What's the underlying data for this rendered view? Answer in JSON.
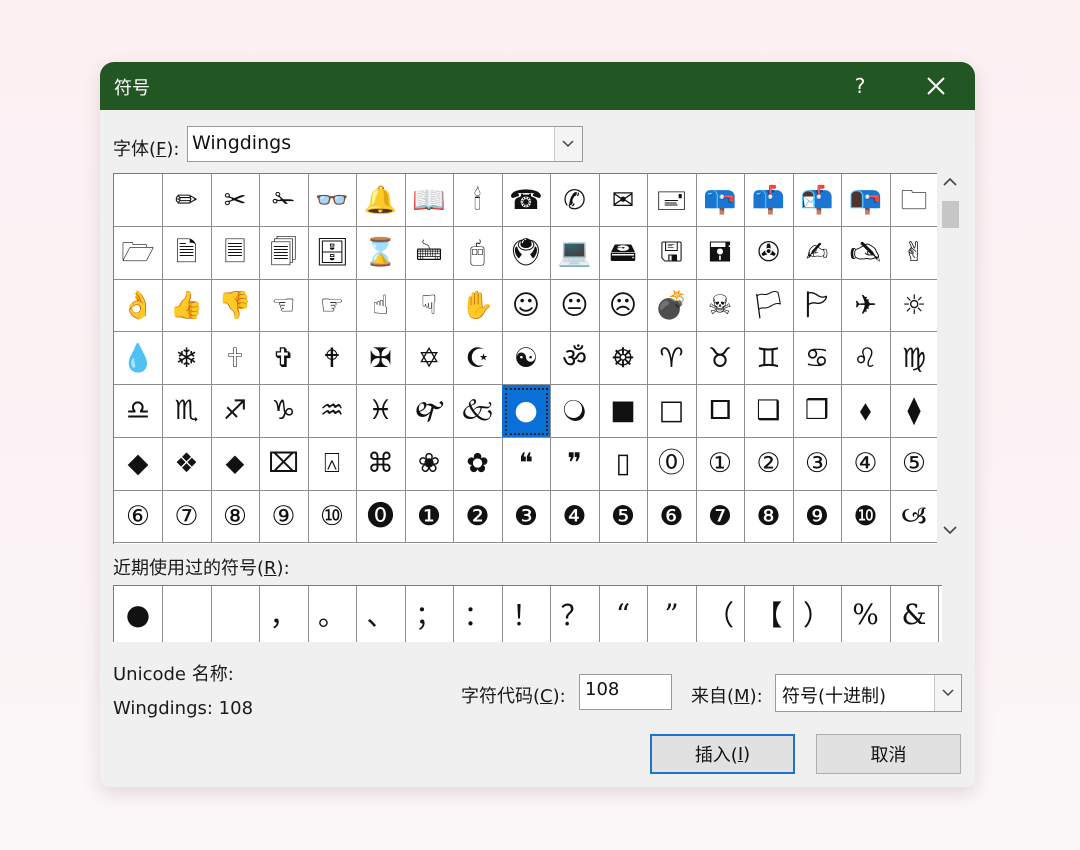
{
  "dialog": {
    "title": "符号",
    "help": "?"
  },
  "font": {
    "label": "字体(",
    "label_key": "F",
    "label_end": "):",
    "value": "Wingdings"
  },
  "symbols": [
    [
      "",
      "✏",
      "✂",
      "✁",
      "👓",
      "🔔",
      "📖",
      "🕯",
      "☎",
      "✆",
      "✉",
      "🖃",
      "📪",
      "📫",
      "📬",
      "📭",
      "🗀"
    ],
    [
      "🗁",
      "🗎",
      "🗏",
      "🗐",
      "🗄",
      "⌛",
      "🖮",
      "🖰",
      "🖲",
      "💻",
      "🖴",
      "🖫",
      "🖬",
      "✇",
      "✍",
      "🖎",
      "✌"
    ],
    [
      "👌",
      "👍",
      "👎",
      "☜",
      "☞",
      "☝",
      "☟",
      "✋",
      "☺",
      "😐",
      "☹",
      "💣",
      "☠",
      "🏳",
      "🏱",
      "✈",
      "☼"
    ],
    [
      "💧",
      "❄",
      "🕆",
      "✞",
      "🕈",
      "✠",
      "✡",
      "☪",
      "☯",
      "ॐ",
      "☸",
      "♈",
      "♉",
      "♊",
      "♋",
      "♌",
      "♍"
    ],
    [
      "♎",
      "♏",
      "♐",
      "♑",
      "♒",
      "♓",
      "🙰",
      "🙵",
      "●",
      "🔾",
      "■",
      "□",
      "🞐",
      "❑",
      "❒",
      "⬧",
      "⧫"
    ],
    [
      "◆",
      "❖",
      "⬥",
      "⌧",
      "⍓",
      "⌘",
      "❀",
      "✿",
      "❝",
      "❞",
      "▯",
      "⓪",
      "①",
      "②",
      "③",
      "④",
      "⑤"
    ],
    [
      "⑥",
      "⑦",
      "⑧",
      "⑨",
      "⑩",
      "⓿",
      "❶",
      "❷",
      "❸",
      "❹",
      "❺",
      "❻",
      "❼",
      "❽",
      "❾",
      "❿",
      "🙢"
    ]
  ],
  "recent": {
    "label": "近期使用过的符号(",
    "label_key": "R",
    "label_end": "):",
    "items": [
      "●",
      "",
      "",
      "，",
      "。",
      "、",
      "；",
      "：",
      "！",
      "？",
      "“",
      "”",
      "（",
      "【",
      "）",
      "%",
      "&"
    ]
  },
  "unicode_name_label": "Unicode 名称:",
  "status": "Wingdings: 108",
  "char_code": {
    "label": "字符代码(",
    "label_key": "C",
    "label_end": "):",
    "value": "108"
  },
  "from": {
    "label": "来自(",
    "label_key": "M",
    "label_end": "):",
    "value": "符号(十进制)"
  },
  "buttons": {
    "insert": "插入(",
    "insert_key": "I",
    "insert_end": ")",
    "cancel": "取消"
  },
  "colors": {
    "titlebar": "#225623",
    "selection": "#0a70d8",
    "dialog_bg": "#f0f0f0"
  }
}
